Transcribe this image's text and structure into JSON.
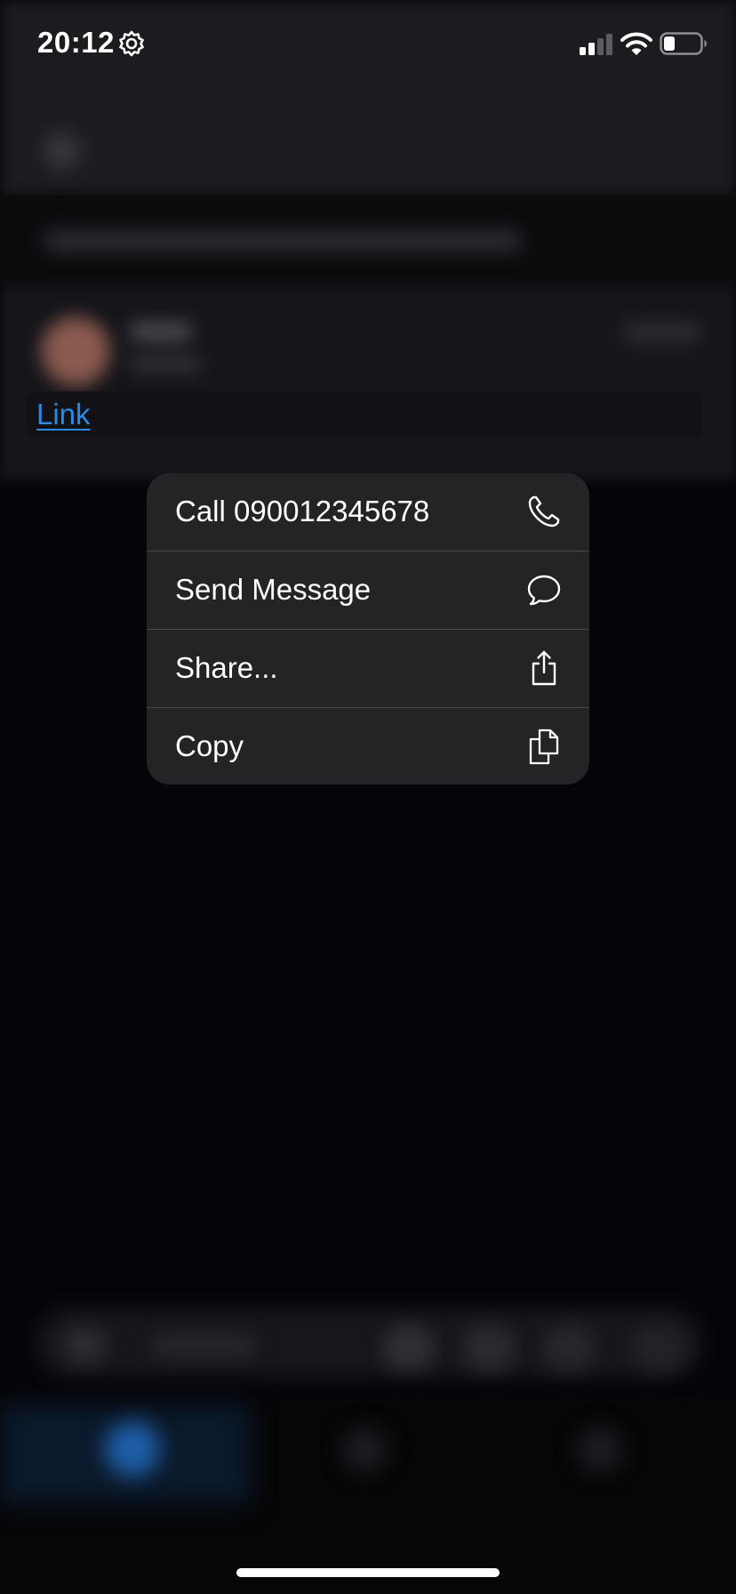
{
  "status_bar": {
    "time": "20:12",
    "icons": [
      "gear-icon",
      "cellular-signal-icon",
      "wifi-icon",
      "battery-icon"
    ]
  },
  "background": {
    "link_text": "Link"
  },
  "context_menu": {
    "items": [
      {
        "label": "Call 090012345678",
        "icon": "phone-icon"
      },
      {
        "label": "Send Message",
        "icon": "message-bubble-icon"
      },
      {
        "label": "Share...",
        "icon": "share-icon"
      },
      {
        "label": "Copy",
        "icon": "copy-icon"
      }
    ]
  },
  "colors": {
    "link": "#2b8ae6",
    "menu_background": "#242427",
    "separator": "#4a4a4f",
    "screen_background": "#050509"
  }
}
